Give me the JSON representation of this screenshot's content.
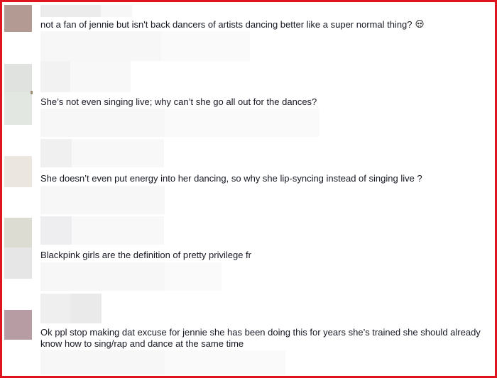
{
  "comments": [
    {
      "text": "not a fan of jennie but isn't back dancers of artists dancing better like a super normal thing?",
      "emoji": "skull-emoji",
      "avatar_color": "#b39a92"
    },
    {
      "text": "She’s not even singing live; why can’t she go all out for the dances?",
      "avatar_color": "#d8dcd8"
    },
    {
      "text": "She doesn’t even put energy into her dancing, so why she lip-syncing instead of singing live ?",
      "avatar_color": "#e8e4dc"
    },
    {
      "text": "Blackpink girls are the definition of pretty privilege fr",
      "avatar_color": "#dcdcd4"
    },
    {
      "text": "Ok ppl stop making dat excuse for jennie she has been doing this for years she’s trained she should already know how to sing/rap and dance at the same time",
      "avatar_color": "#b89ca4"
    }
  ],
  "colors": {
    "border": "#e0141e",
    "text": "#161823"
  }
}
